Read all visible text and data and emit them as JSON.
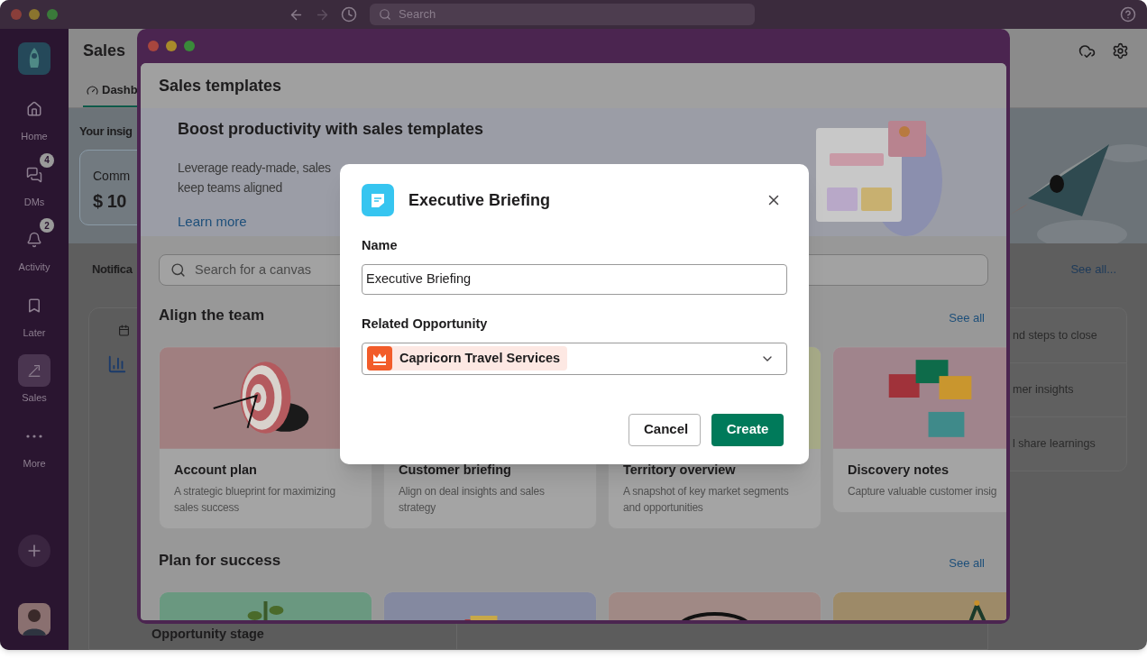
{
  "topbar": {
    "search_placeholder": "Search"
  },
  "sidebar": {
    "items": [
      {
        "label": "Home",
        "kind": "home",
        "selected": false
      },
      {
        "label": "DMs",
        "kind": "dms",
        "badge": "4",
        "selected": false
      },
      {
        "label": "Activity",
        "kind": "activity",
        "badge": "2",
        "selected": false
      },
      {
        "label": "Later",
        "kind": "later",
        "selected": false
      },
      {
        "label": "Sales",
        "kind": "sales",
        "selected": true
      },
      {
        "label": "More",
        "kind": "more",
        "selected": false
      }
    ]
  },
  "page": {
    "title": "Sales",
    "tabs": [
      {
        "label": "Dashb",
        "selected": true
      }
    ],
    "insights_heading": "Your insig",
    "metric": {
      "label": "Comm",
      "value": "$ 10"
    },
    "notifications_heading": "Notifica",
    "see_all": "See all...",
    "list_rows": [
      "nd steps to close",
      "mer insights",
      "l share learnings"
    ],
    "bottom_card_title": "Opportunity stage"
  },
  "templates_window": {
    "title": "Sales templates",
    "hero": {
      "heading": "Boost productivity with sales templates",
      "lines": [
        "Leverage ready-made, sales",
        "keep teams aligned"
      ],
      "link": "Learn more"
    },
    "search": {
      "placeholder": "Search for a canvas"
    },
    "sections": [
      {
        "title": "Align the team",
        "see_all": "See all",
        "cards": [
          {
            "kind": "target",
            "title": "Account plan",
            "description": "A strategic blueprint for maximizing sales success"
          },
          {
            "kind": "blank",
            "title": "Customer briefing",
            "description": "Align on deal insights and sales strategy"
          },
          {
            "kind": "field",
            "title": "Territory overview",
            "description": "A snapshot of key market segments and opportunities"
          },
          {
            "kind": "puzzle",
            "title": "Discovery notes",
            "description": "Capture valuable customer insig"
          }
        ]
      },
      {
        "title": "Plan for success",
        "see_all": "See all",
        "cards": [
          {
            "kind": "plant"
          },
          {
            "kind": "gift"
          },
          {
            "kind": "ring"
          },
          {
            "kind": "antenna"
          }
        ]
      }
    ]
  },
  "dialog": {
    "title": "Executive Briefing",
    "name_field": {
      "label": "Name",
      "value": "Executive Briefing"
    },
    "opportunity": {
      "label": "Related Opportunity",
      "value": "Capricorn Travel Services"
    },
    "buttons": [
      {
        "label": "Cancel",
        "kind": "secondary"
      },
      {
        "label": "Create",
        "kind": "primary"
      }
    ]
  }
}
